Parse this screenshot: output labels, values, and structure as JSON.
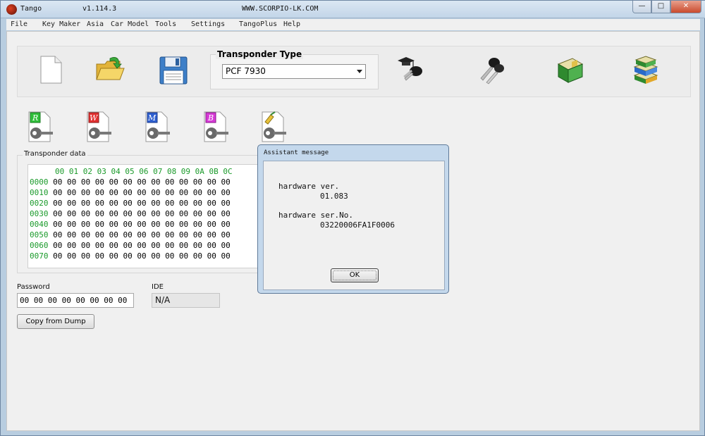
{
  "window": {
    "title": "Tango",
    "version": "v1.114.3",
    "site": "WWW.SCORPIO-LK.COM"
  },
  "menu": [
    "File",
    "Key Maker",
    "Asia",
    "Car Model",
    "Tools",
    "Settings",
    "TangoPlus",
    "Help"
  ],
  "toolbar": {
    "transponder_title": "Transponder Type",
    "transponder_value": "PCF 7930"
  },
  "icons": {
    "read_letter": "R",
    "write_letter": "W",
    "memory_letter": "M",
    "backup_letter": "B"
  },
  "transponder_data": {
    "label": "Transponder data",
    "header": "00 01 02 03 04 05 06 07 08 09 0A 0B 0C",
    "rows": [
      {
        "addr": "0000",
        "values": "00 00 00 00 00 00 00 00 00 00 00 00 00"
      },
      {
        "addr": "0010",
        "values": "00 00 00 00 00 00 00 00 00 00 00 00 00"
      },
      {
        "addr": "0020",
        "values": "00 00 00 00 00 00 00 00 00 00 00 00 00"
      },
      {
        "addr": "0030",
        "values": "00 00 00 00 00 00 00 00 00 00 00 00 00"
      },
      {
        "addr": "0040",
        "values": "00 00 00 00 00 00 00 00 00 00 00 00 00"
      },
      {
        "addr": "0050",
        "values": "00 00 00 00 00 00 00 00 00 00 00 00 00"
      },
      {
        "addr": "0060",
        "values": "00 00 00 00 00 00 00 00 00 00 00 00 00"
      },
      {
        "addr": "0070",
        "values": "00 00 00 00 00 00 00 00 00 00 00 00 00"
      }
    ]
  },
  "password": {
    "label": "Password",
    "value": "00 00 00 00 00 00 00 00"
  },
  "ide": {
    "label": "IDE",
    "value": "N/A"
  },
  "copy_button": "Copy from Dump",
  "dialog": {
    "title": "Assistant message",
    "line1": "hardware ver.",
    "line2": "01.083",
    "line3": "hardware ser.No.",
    "line4": "03220006FA1F0006",
    "ok": "OK"
  },
  "colors": {
    "hex_green": "#1a9a2a",
    "title_bar": "#c2d5e8",
    "close_red": "#c94a2d"
  }
}
